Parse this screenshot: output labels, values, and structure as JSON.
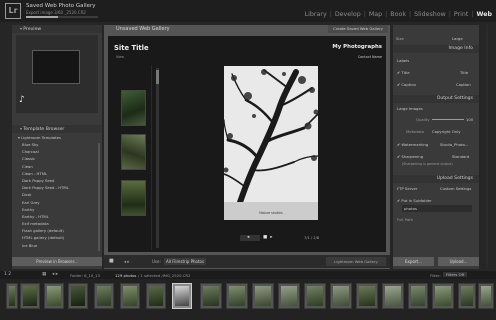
{
  "app": {
    "logo": "Lr",
    "task_title": "Saved Web Photo Gallery",
    "task_subtitle": "Export image 3/60 _2520.CR2",
    "progress_fraction": 0.45
  },
  "modules": [
    {
      "label": "Library",
      "active": false
    },
    {
      "label": "Develop",
      "active": false
    },
    {
      "label": "Map",
      "active": false
    },
    {
      "label": "Book",
      "active": false
    },
    {
      "label": "Slideshow",
      "active": false
    },
    {
      "label": "Print",
      "active": false
    },
    {
      "label": "Web",
      "active": true
    }
  ],
  "left_panel": {
    "preview_header": "Preview",
    "template_header": "Template Browser",
    "folder_label": "Lightroom Templates",
    "templates": [
      "Blue Sky",
      "Charcoal",
      "Classic",
      "Clean",
      "Clean - HTML",
      "Dark Poppy Seed",
      "Dark Poppy Seed - HTML",
      "Dusk",
      "Earl Grey",
      "Earthy",
      "Earthy - HTML",
      "Exif metadata",
      "Flash gallery (default)",
      "HTML gallery (default)",
      "Ice Blue"
    ],
    "preview_in_browser": "Preview in Browser..."
  },
  "right_panel": {
    "style_label": "Size",
    "style_value": "Large",
    "image_info_header": "Image Info",
    "labels_label": "Labels",
    "title_check": "Title",
    "title_value": "Title",
    "caption_check": "Caption",
    "caption_value": "Caption",
    "output_header": "Output Settings",
    "large_images_label": "Large Images",
    "quality_label": "Quality",
    "quality_value": "100",
    "metadata_label": "Metadata",
    "metadata_value": "Copyright Only",
    "watermarking_label": "Watermarking",
    "watermark_value": "Studio_Photo...",
    "sharpening_label": "Sharpening",
    "sharpening_value": "Standard",
    "sharpening_note": "(Sharpening is general output)",
    "upload_header": "Upload Settings",
    "ftp_label": "FTP Server",
    "ftp_value": "Custom Settings",
    "subfolder_check": "Put in Subfolder",
    "subfolder_value": "photos",
    "full_path_label": "Full Path",
    "export_btn": "Export...",
    "upload_btn": "Upload..."
  },
  "center": {
    "window_title": "Unsaved Web Gallery",
    "create_button": "Create Saved Web Gallery",
    "site_title": "Site Title",
    "site_subtitle": "View",
    "collection_title": "My Photographs",
    "contact_name": "Contact Name",
    "photo_caption": "Nature studies",
    "counter": "7/1 / 2/8",
    "player_prev": "◂",
    "player_play": "■",
    "player_next": "▸"
  },
  "center_toolbar": {
    "nav_arrows": "◂   ▸",
    "use_label": "Use:",
    "use_value": "All Filmstrip Photos",
    "preview_button": "Lightroom Web Gallery"
  },
  "bottom_bar": {
    "page_buttons": "1  2",
    "folder_text": "Folder: 6_10_13",
    "photo_count": "129 photos",
    "selected_text": "/ 1 selected /IMG_2520.CR2",
    "filter_label": "Filter:",
    "filter_value": "Filters Off"
  },
  "colors": {
    "selected_border": "#cfcfcf",
    "check_accent": "#d9d9d9"
  }
}
